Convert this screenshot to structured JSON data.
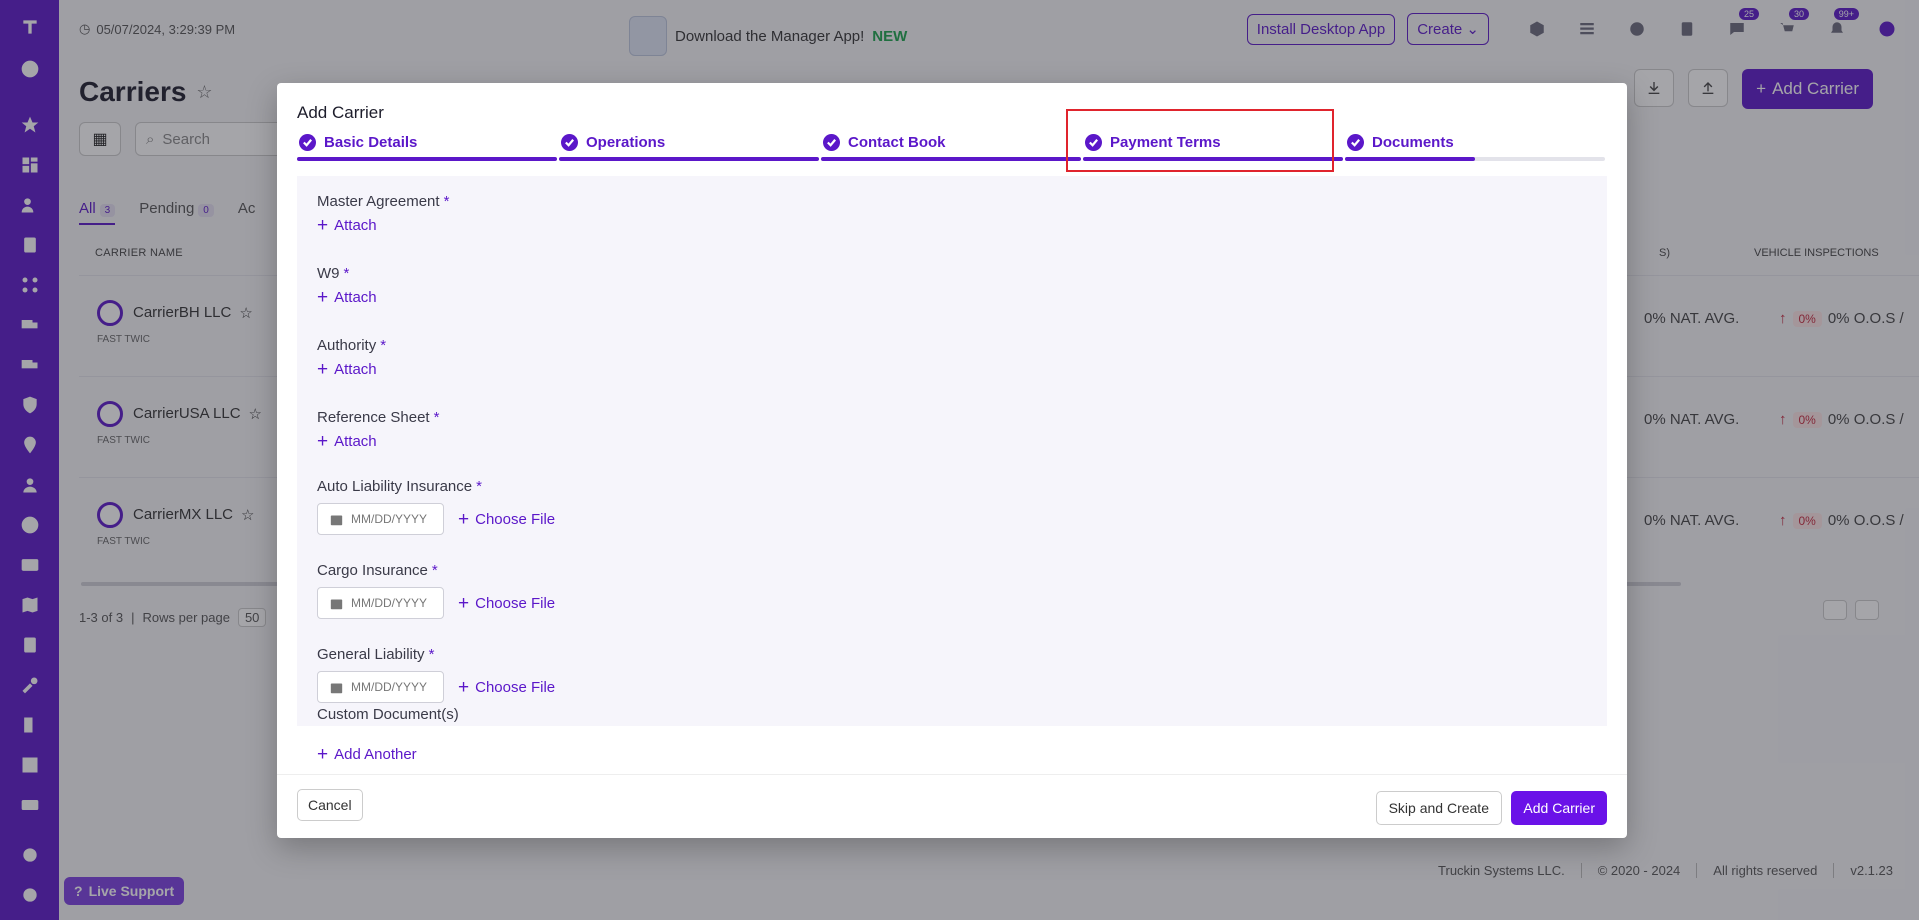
{
  "header": {
    "datetime": "05/07/2024, 3:29:39 PM",
    "promo_text": "Download the Manager App!",
    "promo_new": "NEW",
    "install_label": "Install Desktop App",
    "create_label": "Create",
    "badges": {
      "messages": "25",
      "cart": "30",
      "notifications": "99+"
    }
  },
  "page": {
    "title": "Carriers",
    "add_button": "Add Carrier",
    "search_placeholder": "Search",
    "tabs": [
      {
        "label": "All",
        "count": "3"
      },
      {
        "label": "Pending",
        "count": "0"
      },
      {
        "label": "Ac"
      }
    ],
    "columns": {
      "name": "CARRIER NAME",
      "partial": "S)",
      "vehicle": "VEHICLE INSPECTIONS"
    },
    "rows": [
      {
        "name": "CarrierBH LLC",
        "flags": "FAST TWIC",
        "nat": "0% NAT. AVG.",
        "pct": "0%",
        "oos": "0% O.O.S /"
      },
      {
        "name": "CarrierUSA LLC",
        "flags": "FAST TWIC",
        "nat": "0% NAT. AVG.",
        "pct": "0%",
        "oos": "0% O.O.S /"
      },
      {
        "name": "CarrierMX LLC",
        "flags": "FAST TWIC",
        "nat": "0% NAT. AVG.",
        "pct": "0%",
        "oos": "0% O.O.S /"
      }
    ],
    "pager": {
      "summary": "1-3 of 3",
      "rows_label": "Rows per page",
      "rows_value": "50"
    }
  },
  "footer": {
    "company": "Truckin Systems LLC.",
    "copyright": "© 2020 - 2024",
    "rights": "All rights reserved",
    "version": "v2.1.23"
  },
  "live_support": "Live Support",
  "modal": {
    "title": "Add Carrier",
    "steps": [
      {
        "label": "Basic Details"
      },
      {
        "label": "Operations"
      },
      {
        "label": "Contact Book"
      },
      {
        "label": "Payment Terms"
      },
      {
        "label": "Documents"
      }
    ],
    "fields": {
      "master_agreement": "Master Agreement",
      "w9": "W9",
      "authority": "Authority",
      "reference_sheet": "Reference Sheet",
      "auto_liability": "Auto Liability Insurance",
      "cargo": "Cargo Insurance",
      "general_liability": "General Liability",
      "custom_docs": "Custom Document(s)"
    },
    "required_mark": "*",
    "attach_label": "Attach",
    "choose_file_label": "Choose File",
    "date_placeholder": "MM/DD/YYYY",
    "add_another_label": "Add Another",
    "cancel_label": "Cancel",
    "skip_label": "Skip and Create",
    "submit_label": "Add Carrier"
  },
  "colors": {
    "brand": "#5b17c9",
    "highlight": "#e0242d",
    "danger": "#c5283d"
  }
}
